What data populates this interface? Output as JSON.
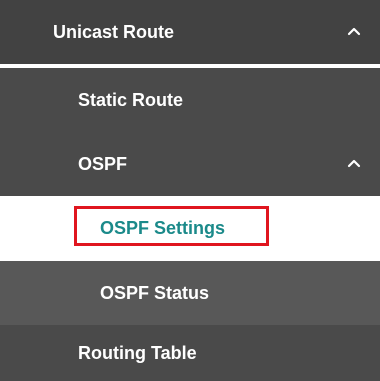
{
  "menu": {
    "unicast_route": {
      "label": "Unicast Route",
      "expanded": true,
      "caret_icon": "chevron-up-icon"
    },
    "static_route": {
      "label": "Static Route"
    },
    "ospf": {
      "label": "OSPF",
      "expanded": true,
      "caret_icon": "chevron-up-icon"
    },
    "ospf_settings": {
      "label": "OSPF Settings",
      "active": true
    },
    "ospf_status": {
      "label": "OSPF Status"
    },
    "routing_table": {
      "label": "Routing Table"
    }
  },
  "colors": {
    "background_level1": "#424242",
    "background_level3": "#585858",
    "active_text": "#1b8a8a",
    "highlight_border": "#e0161f"
  }
}
